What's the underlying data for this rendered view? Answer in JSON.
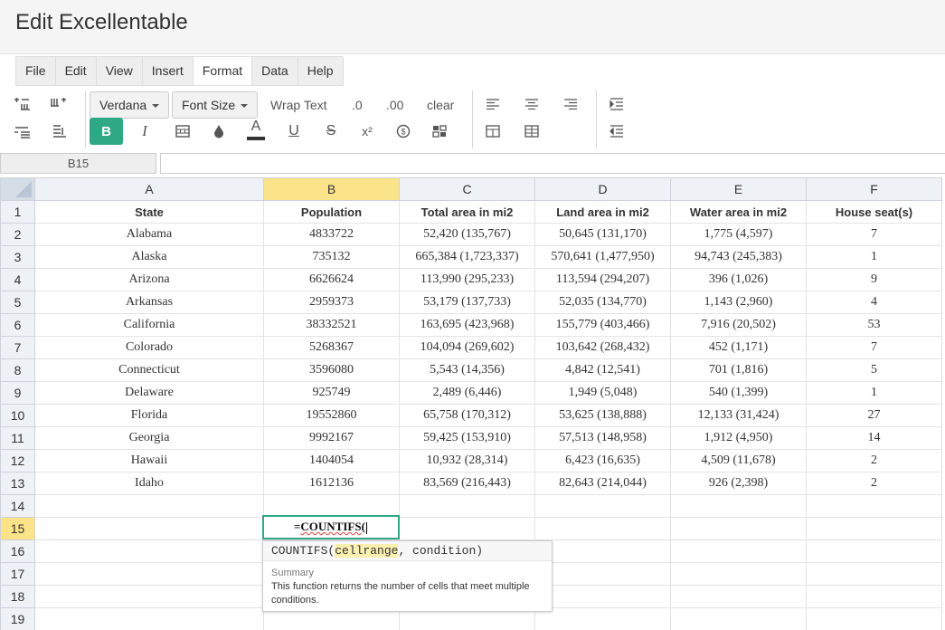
{
  "app": {
    "title": "Edit Excellentable"
  },
  "menu": {
    "items": [
      "File",
      "Edit",
      "View",
      "Insert",
      "Format",
      "Data",
      "Help"
    ],
    "active": "Format"
  },
  "toolbar": {
    "font_family": "Verdana",
    "font_size": "Font Size",
    "wrap_text": "Wrap Text",
    "decimal_one": ".0",
    "decimal_two": ".00",
    "clear": "clear",
    "bold": "B",
    "italic": "I",
    "text_color": "A",
    "underline": "U",
    "strikethrough": "S",
    "superscript": "x²",
    "accent_color": "#2fa886"
  },
  "name_box": {
    "value": "B15"
  },
  "formula_bar": {
    "value": ""
  },
  "sheet": {
    "columns": [
      "A",
      "B",
      "C",
      "D",
      "E",
      "F"
    ],
    "selected_column": "B",
    "selected_row": "15",
    "rows": [
      {
        "num": "1",
        "cells": [
          "State",
          "Population",
          "Total area in mi2",
          "Land area in mi2",
          "Water area in mi2",
          "House seat(s)"
        ]
      },
      {
        "num": "2",
        "cells": [
          "Alabama",
          "4833722",
          "52,420 (135,767)",
          "50,645 (131,170)",
          "1,775 (4,597)",
          "7"
        ]
      },
      {
        "num": "3",
        "cells": [
          "Alaska",
          "735132",
          "665,384 (1,723,337)",
          "570,641 (1,477,950)",
          "94,743 (245,383)",
          "1"
        ]
      },
      {
        "num": "4",
        "cells": [
          "Arizona",
          "6626624",
          "113,990 (295,233)",
          "113,594 (294,207)",
          "396 (1,026)",
          "9"
        ]
      },
      {
        "num": "5",
        "cells": [
          "Arkansas",
          "2959373",
          "53,179 (137,733)",
          "52,035 (134,770)",
          "1,143 (2,960)",
          "4"
        ]
      },
      {
        "num": "6",
        "cells": [
          "California",
          "38332521",
          "163,695 (423,968)",
          "155,779 (403,466)",
          "7,916 (20,502)",
          "53"
        ]
      },
      {
        "num": "7",
        "cells": [
          "Colorado",
          "5268367",
          "104,094 (269,602)",
          "103,642 (268,432)",
          "452 (1,171)",
          "7"
        ]
      },
      {
        "num": "8",
        "cells": [
          "Connecticut",
          "3596080",
          "5,543 (14,356)",
          "4,842 (12,541)",
          "701 (1,816)",
          "5"
        ]
      },
      {
        "num": "9",
        "cells": [
          "Delaware",
          "925749",
          "2,489 (6,446)",
          "1,949 (5,048)",
          "540 (1,399)",
          "1"
        ]
      },
      {
        "num": "10",
        "cells": [
          "Florida",
          "19552860",
          "65,758 (170,312)",
          "53,625 (138,888)",
          "12,133 (31,424)",
          "27"
        ]
      },
      {
        "num": "11",
        "cells": [
          "Georgia",
          "9992167",
          "59,425 (153,910)",
          "57,513 (148,958)",
          "1,912 (4,950)",
          "14"
        ]
      },
      {
        "num": "12",
        "cells": [
          "Hawaii",
          "1404054",
          "10,932 (28,314)",
          "6,423 (16,635)",
          "4,509 (11,678)",
          "2"
        ]
      },
      {
        "num": "13",
        "cells": [
          "Idaho",
          "1612136",
          "83,569 (216,443)",
          "82,643 (214,044)",
          "926 (2,398)",
          "2"
        ]
      },
      {
        "num": "14",
        "cells": [
          "",
          "",
          "",
          "",
          "",
          ""
        ]
      },
      {
        "num": "15",
        "cells": [
          "",
          "",
          "",
          "",
          "",
          ""
        ]
      },
      {
        "num": "16",
        "cells": [
          "",
          "",
          "",
          "",
          "",
          ""
        ]
      },
      {
        "num": "17",
        "cells": [
          "",
          "",
          "",
          "",
          "",
          ""
        ]
      },
      {
        "num": "18",
        "cells": [
          "",
          "",
          "",
          "",
          "",
          ""
        ]
      },
      {
        "num": "19",
        "cells": [
          "",
          "",
          "",
          "",
          "",
          ""
        ]
      }
    ]
  },
  "editor": {
    "prefix": "=",
    "function": "COUNTIFS",
    "open_paren": "("
  },
  "hint": {
    "fn_name": "COUNTIFS(",
    "arg": "cellrange",
    "rest": ", condition)",
    "summary_title": "Summary",
    "summary": "This function returns the number of cells that meet multiple conditions."
  }
}
